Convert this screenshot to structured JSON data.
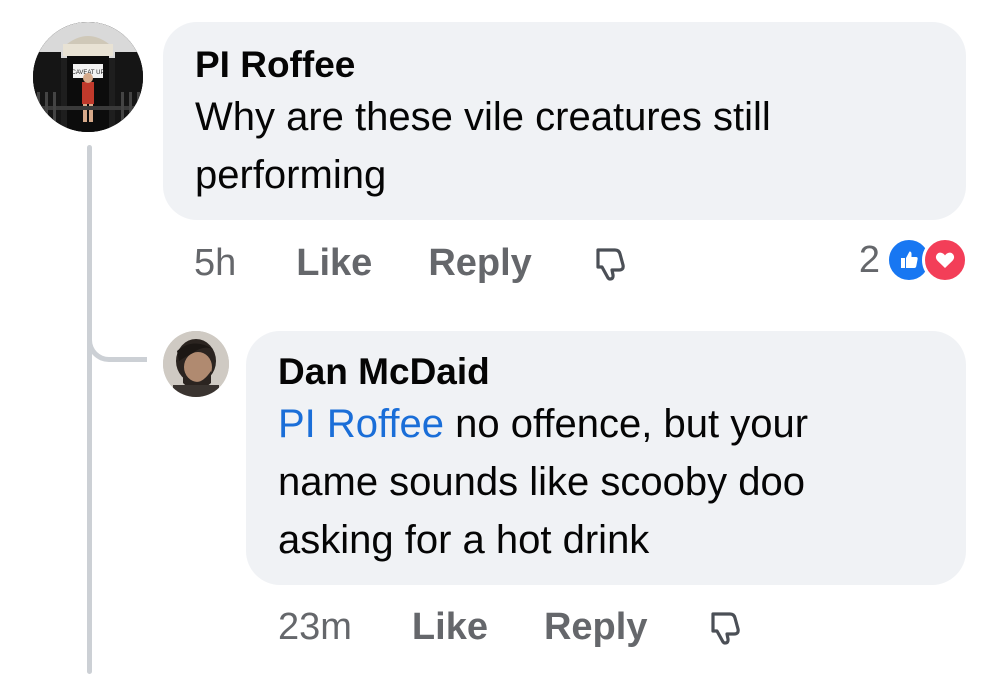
{
  "thread": {
    "main_comment": {
      "author": "PI Roffee",
      "text_line1": "Why are these vile creatures still",
      "text_line2": "performing",
      "time": "5h",
      "like_label": "Like",
      "reply_label": "Reply",
      "reaction_count": "2",
      "reactions": [
        "like-icon",
        "love-icon"
      ],
      "avatar_sign_text": "CAVEAT UP"
    },
    "reply_comment": {
      "author": "Dan McDaid",
      "mention": "PI Roffee",
      "text_line1": " no offence, but your",
      "text_line2": "name sounds like scooby doo",
      "text_line3": "asking for a hot drink",
      "time": "23m",
      "like_label": "Like",
      "reply_label": "Reply"
    }
  },
  "colors": {
    "bubble_bg": "#f0f2f5",
    "secondary_text": "#65676b",
    "mention_blue": "#1a6ed8",
    "like_blue": "#1877f2",
    "love_red": "#f33e58",
    "thread_line": "#ccd0d5"
  }
}
